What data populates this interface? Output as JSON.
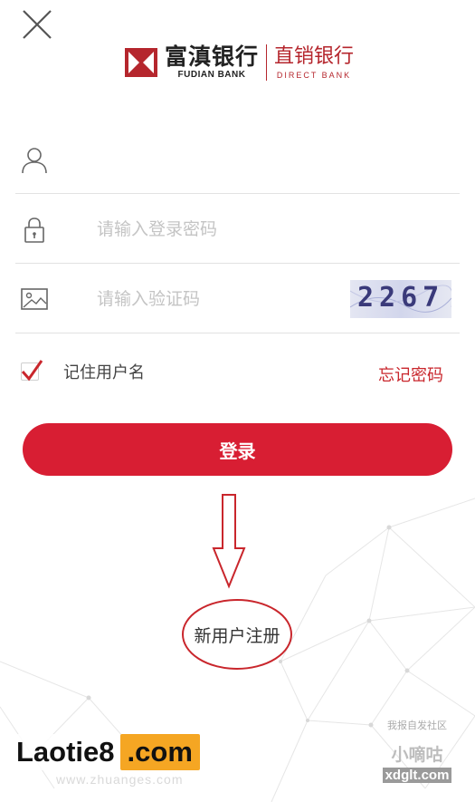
{
  "brand": {
    "name_cn": "富滇银行",
    "name_en": "FUDIAN BANK",
    "sub_cn": "直销银行",
    "sub_en": "DIRECT BANK",
    "color": "#b5262d"
  },
  "icons": {
    "close": "close-icon",
    "user": "user-icon",
    "lock": "lock-icon",
    "image": "image-icon",
    "check": "checkmark-icon",
    "arrow": "down-arrow-icon"
  },
  "form": {
    "username": {
      "value": "",
      "placeholder": ""
    },
    "password": {
      "value": "",
      "placeholder": "请输入登录密码"
    },
    "captcha": {
      "value": "",
      "placeholder": "请输入验证码",
      "image_text": "2267"
    },
    "remember_label": "记住用户名",
    "remember_checked": true,
    "forgot_label": "忘记密码",
    "login_label": "登录",
    "register_label": "新用户注册"
  },
  "colors": {
    "accent": "#d81e33",
    "link": "#c9262c",
    "placeholder": "#c4c4c4",
    "divider": "#e2e2e2"
  },
  "watermarks": {
    "left_a": "Laotie8",
    "left_b": ".com",
    "left_url": "www.zhuanges.com",
    "right_top": "我报自发社区",
    "right_mid": "小嘀咕",
    "right_url": "xdglt.com"
  }
}
